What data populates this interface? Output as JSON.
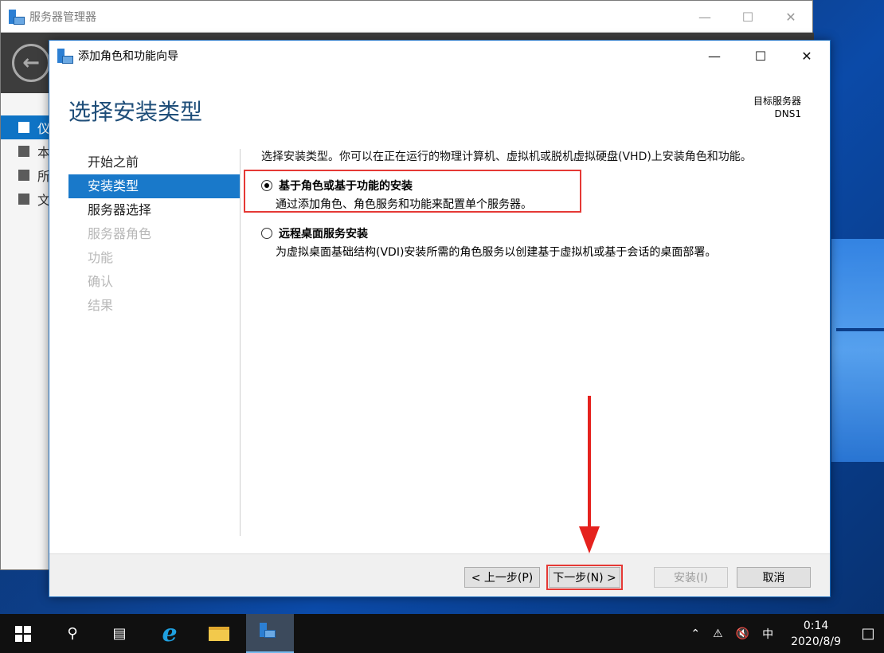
{
  "server_manager": {
    "title": "服务器管理器",
    "nav": [
      "仪",
      "本",
      "所",
      "文"
    ]
  },
  "wizard": {
    "title": "添加角色和功能向导",
    "heading": "选择安装类型",
    "target_label": "目标服务器",
    "target_value": "DNS1",
    "steps": [
      {
        "label": "开始之前",
        "state": "normal"
      },
      {
        "label": "安装类型",
        "state": "active"
      },
      {
        "label": "服务器选择",
        "state": "normal"
      },
      {
        "label": "服务器角色",
        "state": "disabled"
      },
      {
        "label": "功能",
        "state": "disabled"
      },
      {
        "label": "确认",
        "state": "disabled"
      },
      {
        "label": "结果",
        "state": "disabled"
      }
    ],
    "intro": "选择安装类型。你可以在正在运行的物理计算机、虚拟机或脱机虚拟硬盘(VHD)上安装角色和功能。",
    "options": [
      {
        "label": "基于角色或基于功能的安装",
        "description": "通过添加角色、角色服务和功能来配置单个服务器。",
        "checked": true
      },
      {
        "label": "远程桌面服务安装",
        "description": "为虚拟桌面基础结构(VDI)安装所需的角色服务以创建基于虚拟机或基于会话的桌面部署。",
        "checked": false
      }
    ],
    "buttons": {
      "prev": "< 上一步(P)",
      "next": "下一步(N) >",
      "install": "安装(I)",
      "cancel": "取消"
    }
  },
  "taskbar": {
    "ime": "中",
    "time": "0:14",
    "date": "2020/8/9"
  },
  "colors": {
    "accent": "#1979ca",
    "heading": "#1f4e79",
    "annotation_red": "#e53935"
  }
}
